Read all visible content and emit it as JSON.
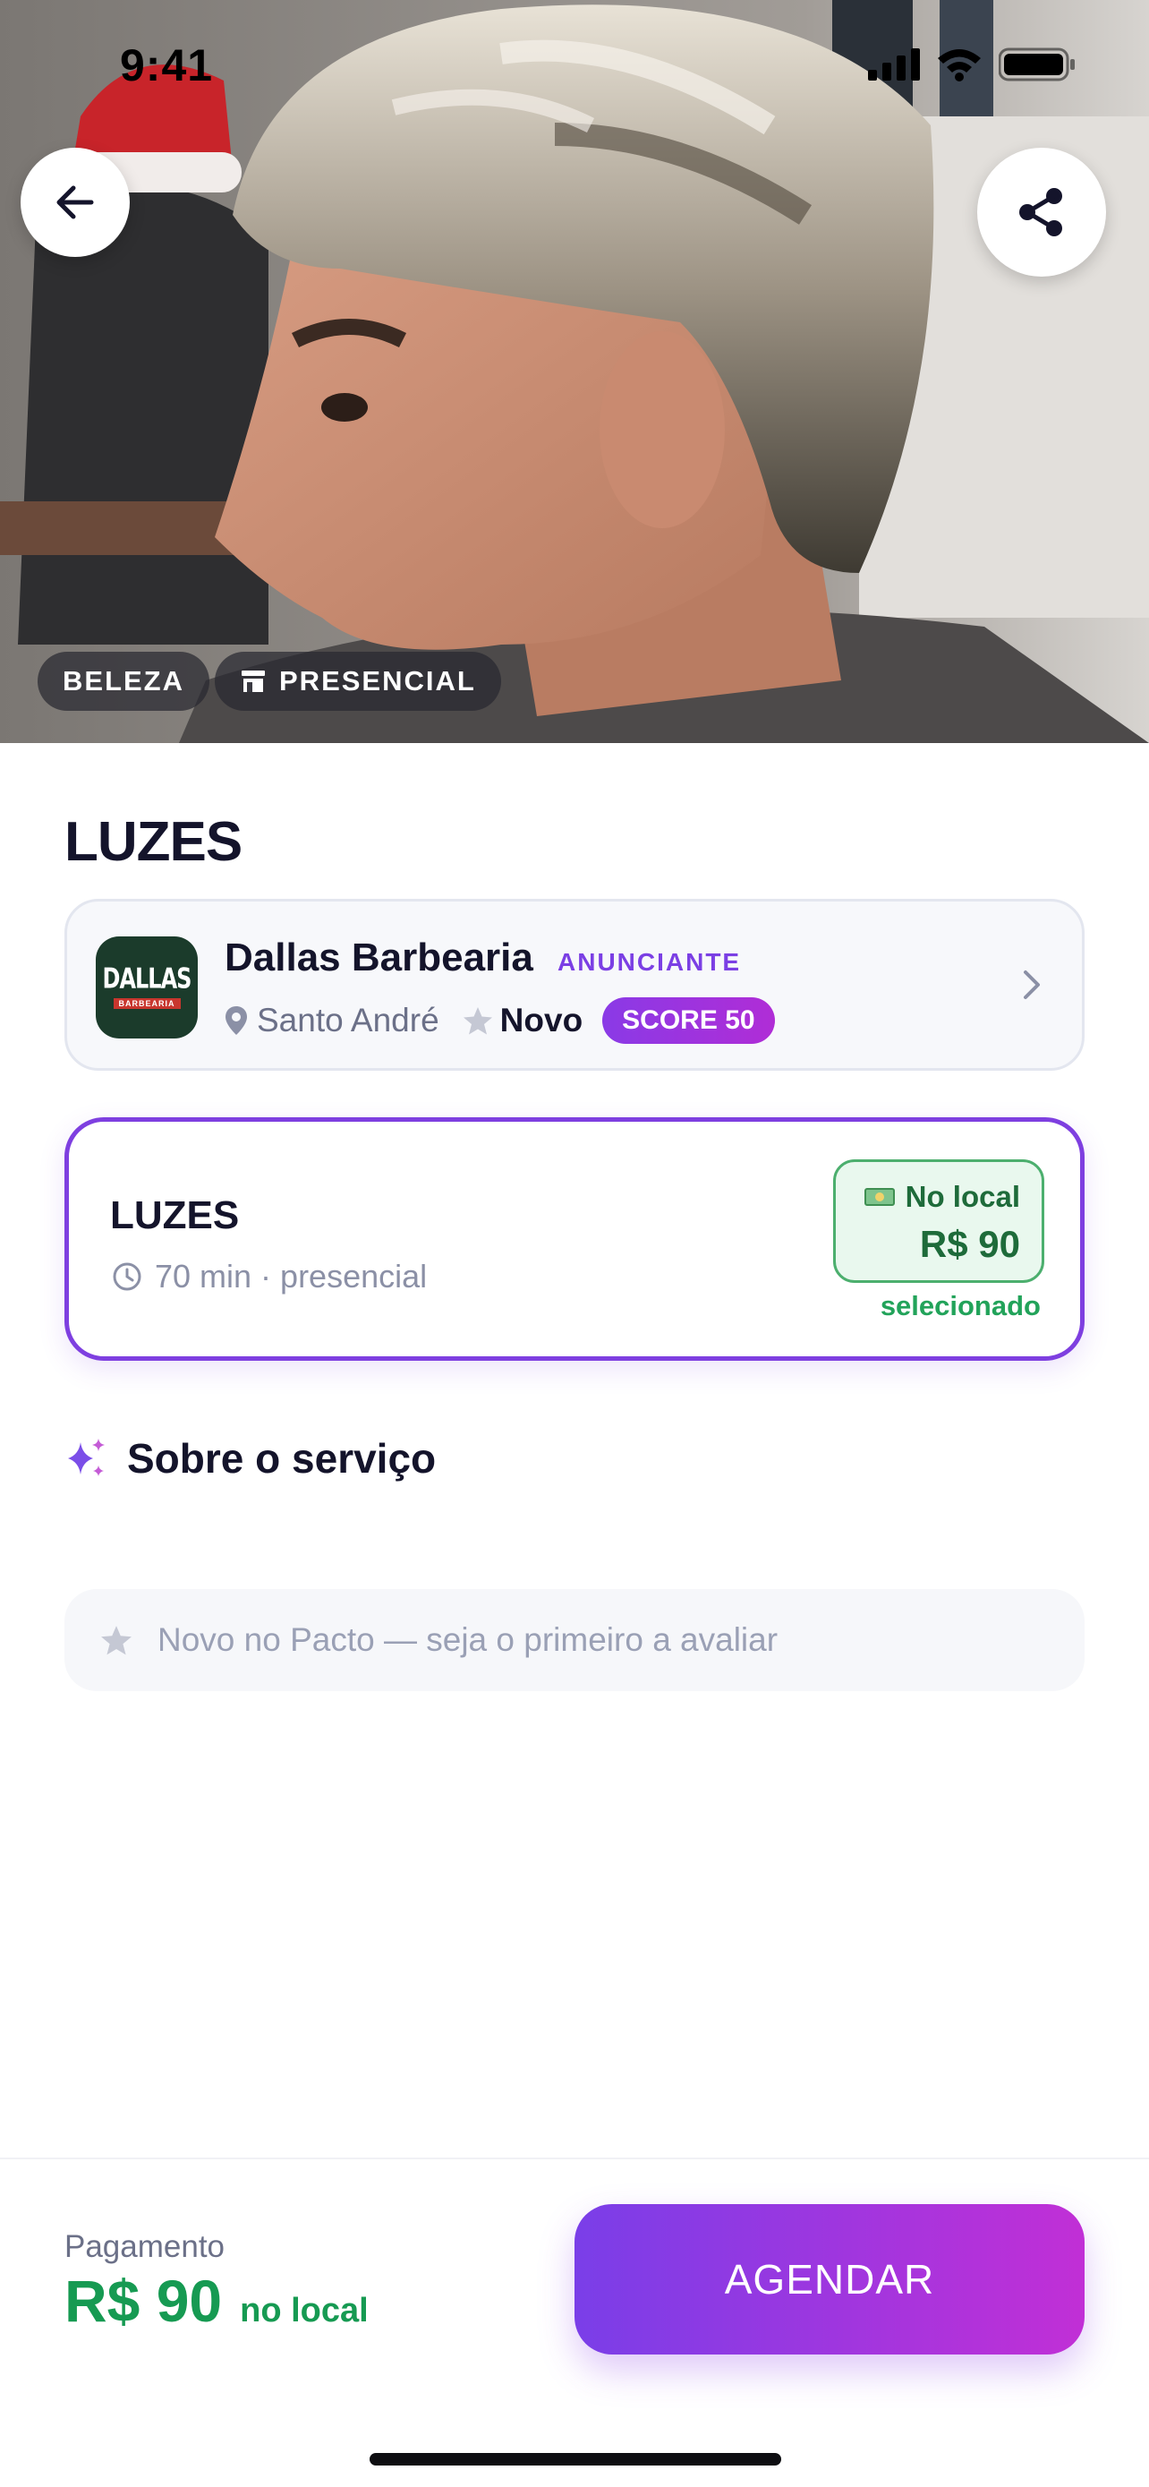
{
  "status_bar": {
    "time": "9:41"
  },
  "hero": {
    "chips": [
      {
        "label": "BELEZA"
      },
      {
        "label": "PRESENCIAL",
        "icon": "store-icon"
      }
    ]
  },
  "service_title": "LUZES",
  "provider": {
    "name": "Dallas Barbearia",
    "tag": "ANUNCIANTE",
    "location": "Santo André",
    "rating_label": "Novo",
    "score": "SCORE 50",
    "logo_text": "DALLAS",
    "logo_subtext": "BARBEARIA"
  },
  "service_option": {
    "name": "LUZES",
    "duration": "70 min · presencial",
    "payment_label": "No local",
    "price": "R$ 90",
    "selected_label": "selecionado"
  },
  "about": {
    "label": "Sobre o serviço"
  },
  "reviews": {
    "empty_text": "Novo no Pacto — seja o primeiro a avaliar"
  },
  "bottom": {
    "payment_label": "Pagamento",
    "price": "R$ 90",
    "price_suffix": "no local",
    "cta_label": "AGENDAR"
  },
  "colors": {
    "accent_purple": "#7e3fe0",
    "price_green": "#169a52",
    "cta_gradient_start": "#7a3ee8",
    "cta_gradient_end": "#c12fd6"
  }
}
